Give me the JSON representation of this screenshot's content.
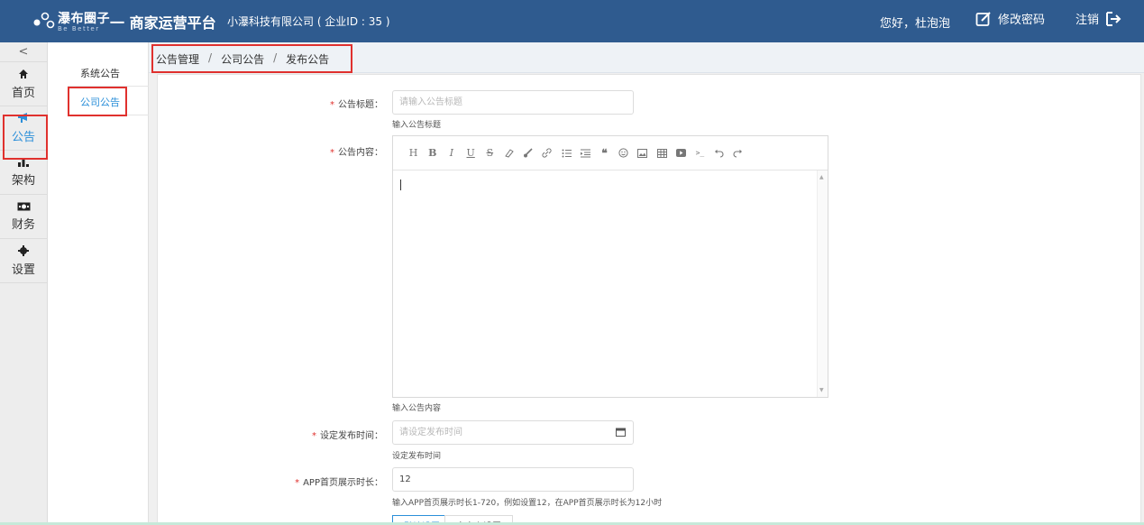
{
  "header": {
    "logo_name": "瀑布圈子",
    "logo_tagline": "Be Better",
    "platform": "一 商家运营平台",
    "company": "小瀑科技有限公司 ( 企业ID : 35 )",
    "greeting": "您好，杜泡泡",
    "change_password": "修改密码",
    "logout": "注销",
    "bg_color": "#2f5b8f"
  },
  "rail": {
    "collapse_icon": "chevron-left-icon",
    "items": [
      {
        "label": "首页",
        "icon": "home-icon"
      },
      {
        "label": "公告",
        "icon": "megaphone-icon",
        "active": true
      },
      {
        "label": "架构",
        "icon": "bar-chart-icon"
      },
      {
        "label": "财务",
        "icon": "money-icon"
      },
      {
        "label": "设置",
        "icon": "gear-icon"
      }
    ]
  },
  "subnav": {
    "items": [
      {
        "label": "系统公告"
      },
      {
        "label": "公司公告",
        "active": true
      }
    ]
  },
  "breadcrumb": [
    "公告管理",
    "公司公告",
    "发布公告"
  ],
  "form": {
    "title_label": "公告标题：",
    "title_placeholder": "请输入公告标题",
    "title_help": "输入公告标题",
    "content_label": "公告内容：",
    "content_help": "输入公告内容",
    "toolbar_icons": [
      "heading-icon",
      "bold-icon",
      "italic-icon",
      "underline-icon",
      "strikethrough-icon",
      "eraser-icon",
      "brush-icon",
      "link-icon",
      "list-icon",
      "indent-icon",
      "quote-icon",
      "emoji-icon",
      "image-icon",
      "table-icon",
      "video-icon",
      "code-icon",
      "undo-icon",
      "redo-icon"
    ],
    "toolbar_glyphs": {
      "heading": "H",
      "bold": "B",
      "italic": "I",
      "underline": "U",
      "strike": "S",
      "quote": "❝",
      "code": ">_"
    },
    "time_label": "设定发布时间：",
    "time_placeholder": "请设定发布时间",
    "time_help": "设定发布时间",
    "duration_label": "APP首页展示时长：",
    "duration_value": "12",
    "duration_help": "输入APP首页展示时长1-720，例如设置12，在APP首页展示时长为12小时",
    "option_a": "默认设置",
    "option_b": "自定义设置"
  },
  "colors": {
    "accent": "#2b8fd9",
    "required": "#e0312e",
    "highlight": "#e0312e"
  }
}
